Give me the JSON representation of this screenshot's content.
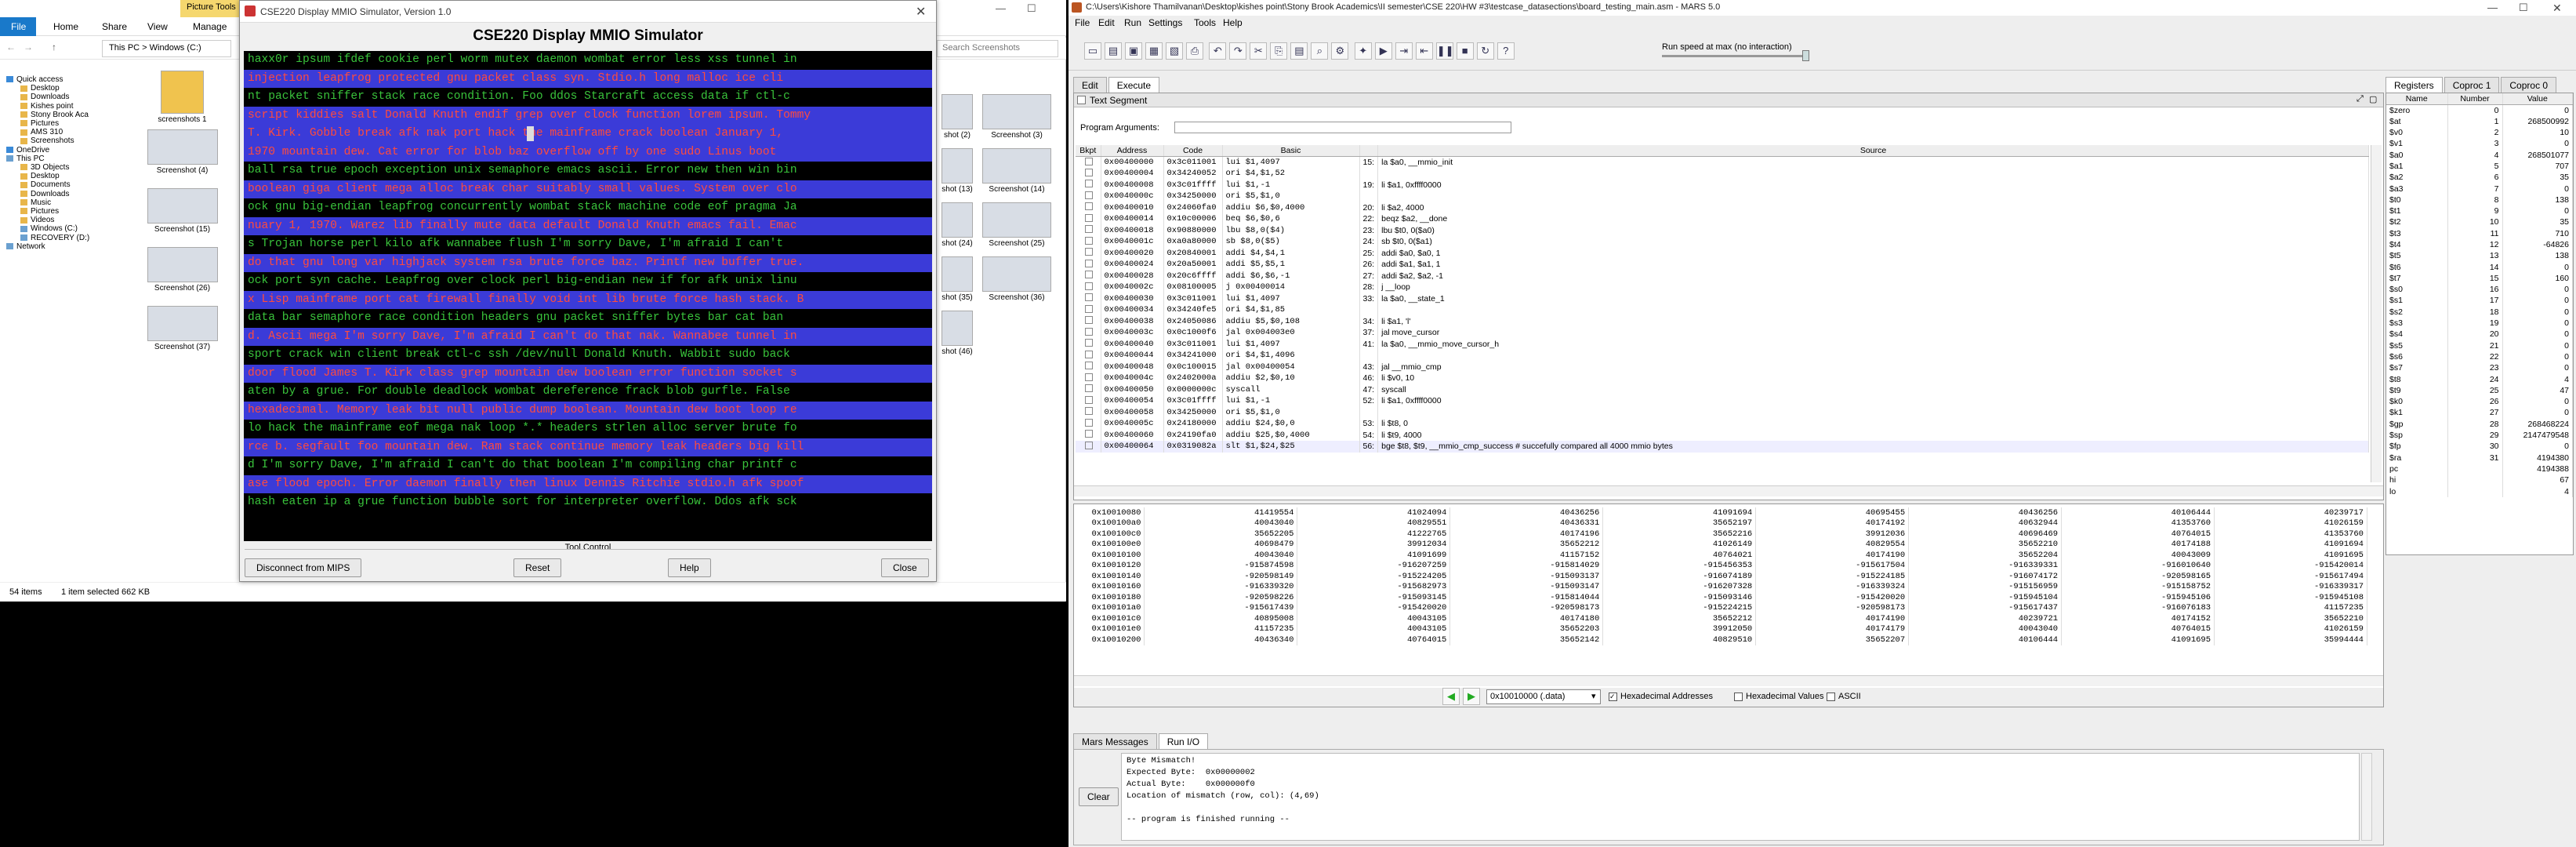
{
  "explorer": {
    "ribbon_context": "Picture Tools",
    "ribbon_tabs": [
      "File",
      "Home",
      "Share",
      "View",
      "Manage"
    ],
    "address": [
      "This PC",
      "Windows (C:)"
    ],
    "search_placeholder": "Search Screenshots",
    "nav": [
      {
        "label": "Quick access",
        "icon": "star-icon"
      },
      {
        "label": "Desktop",
        "icon": "desktop-icon"
      },
      {
        "label": "Downloads",
        "icon": "download-icon"
      },
      {
        "label": "Kishes point",
        "icon": "folder-icon"
      },
      {
        "label": "Stony Brook Aca",
        "icon": "folder-icon"
      },
      {
        "label": "Pictures",
        "icon": "pictures-icon"
      },
      {
        "label": "AMS 310",
        "icon": "folder-icon"
      },
      {
        "label": "Screenshots",
        "icon": "folder-icon"
      },
      {
        "label": "OneDrive",
        "icon": "cloud-icon"
      },
      {
        "label": "This PC",
        "icon": "computer-icon"
      },
      {
        "label": "3D Objects",
        "icon": "cube-icon"
      },
      {
        "label": "Desktop",
        "icon": "desktop-icon"
      },
      {
        "label": "Documents",
        "icon": "document-icon"
      },
      {
        "label": "Downloads",
        "icon": "download-icon"
      },
      {
        "label": "Music",
        "icon": "music-icon"
      },
      {
        "label": "Pictures",
        "icon": "pictures-icon"
      },
      {
        "label": "Videos",
        "icon": "video-icon"
      },
      {
        "label": "Windows (C:)",
        "icon": "drive-icon"
      },
      {
        "label": "RECOVERY (D:)",
        "icon": "drive-icon"
      },
      {
        "label": "Network",
        "icon": "network-icon"
      }
    ],
    "files_left": [
      "screenshots 1",
      "Screenshot (4)",
      "Screenshot (15)",
      "Screenshot (26)",
      "Screenshot (37)"
    ],
    "files_right": [
      "shot (2)",
      "Screenshot (3)",
      "shot (13)",
      "Screenshot (14)",
      "shot (24)",
      "Screenshot (25)",
      "shot (35)",
      "Screenshot (36)",
      "shot (46)"
    ],
    "status_count": "54 items",
    "status_selected": "1 item selected  662 KB"
  },
  "mmio": {
    "window_title": "CSE220 Display MMIO Simulator, Version 1.0",
    "heading": "CSE220 Display MMIO Simulator",
    "lines": [
      {
        "text": "haxx0r ipsum ifdef cookie perl worm mutex daemon wombat error less xss tunnel in",
        "hl": false
      },
      {
        "text": "injection leapfrog protected gnu packet class syn. Stdio.h long malloc ice cli",
        "hl": true
      },
      {
        "text": "nt packet sniffer stack race condition. Foo ddos Starcraft access data if ctl-c",
        "hl": false
      },
      {
        "text": "script kiddies salt Donald Knuth endif grep over clock function lorem ipsum. Tommy",
        "hl": true
      },
      {
        "text": "T. Kirk. Gobble break afk nak port hack the mainframe crack boolean January 1,",
        "hl": true
      },
      {
        "text": "1970 mountain dew. Cat error for blob baz overflow off by one sudo Linus boot",
        "hl": true
      },
      {
        "text": "ball rsa true epoch exception unix semaphore emacs ascii. Error new then win bin",
        "hl": false
      },
      {
        "text": "boolean giga client mega alloc break char suitably small values. System over clo",
        "hl": true
      },
      {
        "text": "ock gnu big-endian leapfrog concurrently wombat stack machine code eof pragma Ja",
        "hl": false
      },
      {
        "text": "nuary 1, 1970. Warez lib finally mute data default Donald Knuth emacs fail. Emac",
        "hl": true
      },
      {
        "text": "s Trojan horse perl kilo afk wannabee flush I'm sorry Dave, I'm afraid I can't",
        "hl": false
      },
      {
        "text": "do that gnu long var highjack system rsa brute force baz. Printf new buffer true.",
        "hl": true
      },
      {
        "text": "ock port syn cache. Leapfrog over clock perl big-endian new if for afk unix linu",
        "hl": false
      },
      {
        "text": "x Lisp mainframe port cat firewall finally void int lib brute force hash stack. B",
        "hl": true
      },
      {
        "text": "data bar semaphore race condition headers gnu packet sniffer bytes bar cat ban",
        "hl": false
      },
      {
        "text": "d. Ascii mega I'm sorry Dave, I'm afraid I can't do that nak. Wannabee tunnel in",
        "hl": true
      },
      {
        "text": "sport crack win client break ctl-c ssh /dev/null Donald Knuth. Wabbit sudo back",
        "hl": false
      },
      {
        "text": "door flood James T. Kirk class grep mountain dew boolean error function socket s",
        "hl": true
      },
      {
        "text": "aten by a grue. For double deadlock wombat dereference frack blob gurfle. False",
        "hl": false
      },
      {
        "text": "hexadecimal. Memory leak bit null public dump boolean. Mountain dew boot loop re",
        "hl": true
      },
      {
        "text": "lo hack the mainframe eof mega nak loop *.* headers strlen alloc server brute fo",
        "hl": false
      },
      {
        "text": "rce b. segfault foo mountain dew. Ram stack continue memory leak headers big kill",
        "hl": true
      },
      {
        "text": "d I'm sorry Dave, I'm afraid I can't do that boolean I'm compiling char printf c",
        "hl": false
      },
      {
        "text": "ase flood epoch. Error daemon finally then linux Dennis Ritchie stdio.h afk spoof",
        "hl": true
      },
      {
        "text": "hash eaten ip a grue function bubble sort for interpreter overflow. Ddos afk sck",
        "hl": false
      }
    ],
    "cursor_line": 4,
    "footer_label": "Tool Control",
    "buttons": {
      "disconnect": "Disconnect from MIPS",
      "reset": "Reset",
      "help": "Help",
      "close": "Close"
    },
    "colors": {
      "bg": "#000000",
      "fg_green": "#39c33b",
      "fg_red": "#ff4b3d",
      "hl_blue": "#3b3bd8"
    }
  },
  "mars": {
    "title": "C:\\Users\\Kishore Thamilvanan\\Desktop\\kishes point\\Stony Brook Academics\\II semester\\CSE 220\\HW #3\\testcase_datasections\\board_testing_main.asm  - MARS 5.0",
    "menu": [
      "File",
      "Edit",
      "Run",
      "Settings",
      "Tools",
      "Help"
    ],
    "run_speed": "Run speed at max (no interaction)",
    "tabs": [
      "Edit",
      "Execute"
    ],
    "text_segment_title": "Text Segment",
    "program_args_label": "Program Arguments:",
    "seg_headers": [
      "Bkpt",
      "Address",
      "Code",
      "Basic",
      "",
      "Source"
    ],
    "seg_rows": [
      [
        "0x00400000",
        "0x3c011001",
        "lui $1,4097",
        "15:",
        "la $a0, __mmio_init"
      ],
      [
        "0x00400004",
        "0x34240052",
        "ori $4,$1,52",
        "",
        ""
      ],
      [
        "0x00400008",
        "0x3c01ffff",
        "lui $1,-1",
        "19:",
        "li $a1, 0xffff0000"
      ],
      [
        "0x0040000c",
        "0x34250000",
        "ori $5,$1,0",
        "",
        ""
      ],
      [
        "0x00400010",
        "0x24060fa0",
        "addiu $6,$0,4000",
        "20:",
        "li $a2, 4000"
      ],
      [
        "0x00400014",
        "0x10c00006",
        "beq $6,$0,6",
        "22:",
        "beqz $a2, __done"
      ],
      [
        "0x00400018",
        "0x90880000",
        "lbu $8,0($4)",
        "23:",
        "lbu $t0, 0($a0)"
      ],
      [
        "0x0040001c",
        "0xa0a80000",
        "sb $8,0($5)",
        "24:",
        "sb $t0, 0($a1)"
      ],
      [
        "0x00400020",
        "0x20840001",
        "addi $4,$4,1",
        "25:",
        "addi $a0, $a0, 1"
      ],
      [
        "0x00400024",
        "0x20a50001",
        "addi $5,$5,1",
        "26:",
        "addi $a1, $a1, 1"
      ],
      [
        "0x00400028",
        "0x20c6ffff",
        "addi $6,$6,-1",
        "27:",
        "addi $a2, $a2, -1"
      ],
      [
        "0x0040002c",
        "0x08100005",
        "j 0x00400014",
        "28:",
        "j __loop"
      ],
      [
        "0x00400030",
        "0x3c011001",
        "lui $1,4097",
        "33:",
        "la $a0, __state_1"
      ],
      [
        "0x00400034",
        "0x34240fe5",
        "ori $4,$1,85",
        "",
        ""
      ],
      [
        "0x00400038",
        "0x24050086",
        "addiu $5,$0,108",
        "34:",
        "li $a1, 'l'"
      ],
      [
        "0x0040003c",
        "0x0c1000f6",
        "jal 0x004003e0",
        "37:",
        "jal move_cursor"
      ],
      [
        "0x00400040",
        "0x3c011001",
        "lui $1,4097",
        "41:",
        "la $a0, __mmio_move_cursor_h"
      ],
      [
        "0x00400044",
        "0x34241000",
        "ori $4,$1,4096",
        "",
        ""
      ],
      [
        "0x00400048",
        "0x0c100015",
        "jal 0x00400054",
        "43:",
        "jal __mmio_cmp"
      ],
      [
        "0x0040004c",
        "0x2402000a",
        "addiu $2,$0,10",
        "46:",
        "li $v0, 10"
      ],
      [
        "0x00400050",
        "0x0000000c",
        "syscall",
        "47:",
        "syscall"
      ],
      [
        "0x00400054",
        "0x3c01ffff",
        "lui $1,-1",
        "52:",
        "li $a1, 0xffff0000"
      ],
      [
        "0x00400058",
        "0x34250000",
        "ori $5,$1,0",
        "",
        ""
      ],
      [
        "0x0040005c",
        "0x24180000",
        "addiu $24,$0,0",
        "53:",
        "li $t8, 0"
      ],
      [
        "0x00400060",
        "0x24190fa0",
        "addiu $25,$0,4000",
        "54:",
        "li $t9, 4000"
      ],
      [
        "0x00400064",
        "0x0319082a",
        "slt $1,$24,$25",
        "56:",
        "bge $t8, $t9, __mmio_cmp_success # succefully compared all 4000 mmio bytes"
      ]
    ],
    "data_rows": [
      [
        "0x10010080",
        "41419554",
        "41024094",
        "40436256",
        "41091694",
        "40695455",
        "40436256",
        "40106444",
        "40239717"
      ],
      [
        "0x100100a0",
        "40043040",
        "40829551",
        "40436331",
        "35652197",
        "40174192",
        "40632944",
        "41353760",
        "41026159"
      ],
      [
        "0x100100c0",
        "35652205",
        "41222765",
        "40174196",
        "35652216",
        "39912036",
        "40696469",
        "40764015",
        "41353760"
      ],
      [
        "0x100100e0",
        "40698479",
        "39912034",
        "35652212",
        "41026149",
        "40829554",
        "35652210",
        "40174188",
        "41091694"
      ],
      [
        "0x10010100",
        "40043040",
        "41091699",
        "41157152",
        "40764021",
        "40174190",
        "35652204",
        "40043009",
        "41091695"
      ],
      [
        "0x10010120",
        "-915874598",
        "-916207259",
        "-915814029",
        "-915456353",
        "-915617504",
        "-916339331",
        "-916010640",
        "-915420014"
      ],
      [
        "0x10010140",
        "-920598149",
        "-915224205",
        "-915093137",
        "-916074189",
        "-915224185",
        "-916074172",
        "-920598165",
        "-915617494"
      ],
      [
        "0x10010160",
        "-916339320",
        "-915682973",
        "-915093147",
        "-916207328",
        "-916339324",
        "-915156959",
        "-915158752",
        "-916339317"
      ],
      [
        "0x10010180",
        "-920598226",
        "-915093145",
        "-915814044",
        "-915093146",
        "-915420020",
        "-915945104",
        "-915945106",
        "-915945108"
      ],
      [
        "0x100101a0",
        "-915617439",
        "-915420020",
        "-920598173",
        "-915224215",
        "-920598173",
        "-915617437",
        "-916076183",
        "41157235"
      ],
      [
        "0x100101c0",
        "40895008",
        "40043105",
        "40174180",
        "35652212",
        "40174190",
        "40239721",
        "40174152",
        "35652210"
      ],
      [
        "0x100101e0",
        "41157235",
        "40043105",
        "35652203",
        "39912050",
        "40174179",
        "40043040",
        "40764015",
        "41026159"
      ],
      [
        "0x10010200",
        "40436340",
        "40764015",
        "35652142",
        "40829510",
        "35652207",
        "40106444",
        "41091695",
        "35994444"
      ]
    ],
    "address_select": "0x10010000 (.data)",
    "hex_addresses_label": "Hexadecimal Addresses",
    "hex_values_label": "Hexadecimal Values",
    "ascii_label": "ASCII",
    "bottom_tabs": [
      "Mars Messages",
      "Run I/O"
    ],
    "clear_label": "Clear",
    "runio_lines": [
      "Byte Mismatch!",
      "Expected Byte:  0x00000002",
      "Actual Byte:    0x000000f0",
      "Location of mismatch (row, col): (4,69)",
      "",
      "-- program is finished running --"
    ],
    "reg_tabs": [
      "Registers",
      "Coproc 1",
      "Coproc 0"
    ],
    "reg_headers": [
      "Name",
      "Number",
      "Value"
    ],
    "registers": [
      [
        "$zero",
        "0",
        "0"
      ],
      [
        "$at",
        "1",
        "268500992"
      ],
      [
        "$v0",
        "2",
        "10"
      ],
      [
        "$v1",
        "3",
        "0"
      ],
      [
        "$a0",
        "4",
        "268501077"
      ],
      [
        "$a1",
        "5",
        "707"
      ],
      [
        "$a2",
        "6",
        "35"
      ],
      [
        "$a3",
        "7",
        "0"
      ],
      [
        "$t0",
        "8",
        "138"
      ],
      [
        "$t1",
        "9",
        "0"
      ],
      [
        "$t2",
        "10",
        "35"
      ],
      [
        "$t3",
        "11",
        "710"
      ],
      [
        "$t4",
        "12",
        "-64826"
      ],
      [
        "$t5",
        "13",
        "138"
      ],
      [
        "$t6",
        "14",
        "0"
      ],
      [
        "$t7",
        "15",
        "160"
      ],
      [
        "$s0",
        "16",
        "0"
      ],
      [
        "$s1",
        "17",
        "0"
      ],
      [
        "$s2",
        "18",
        "0"
      ],
      [
        "$s3",
        "19",
        "0"
      ],
      [
        "$s4",
        "20",
        "0"
      ],
      [
        "$s5",
        "21",
        "0"
      ],
      [
        "$s6",
        "22",
        "0"
      ],
      [
        "$s7",
        "23",
        "0"
      ],
      [
        "$t8",
        "24",
        "4"
      ],
      [
        "$t9",
        "25",
        "47"
      ],
      [
        "$k0",
        "26",
        "0"
      ],
      [
        "$k1",
        "27",
        "0"
      ],
      [
        "$gp",
        "28",
        "268468224"
      ],
      [
        "$sp",
        "29",
        "2147479548"
      ],
      [
        "$fp",
        "30",
        "0"
      ],
      [
        "$ra",
        "31",
        "4194380"
      ],
      [
        "pc",
        "",
        "4194388"
      ],
      [
        "hi",
        "",
        "67"
      ],
      [
        "lo",
        "",
        "4"
      ]
    ]
  }
}
